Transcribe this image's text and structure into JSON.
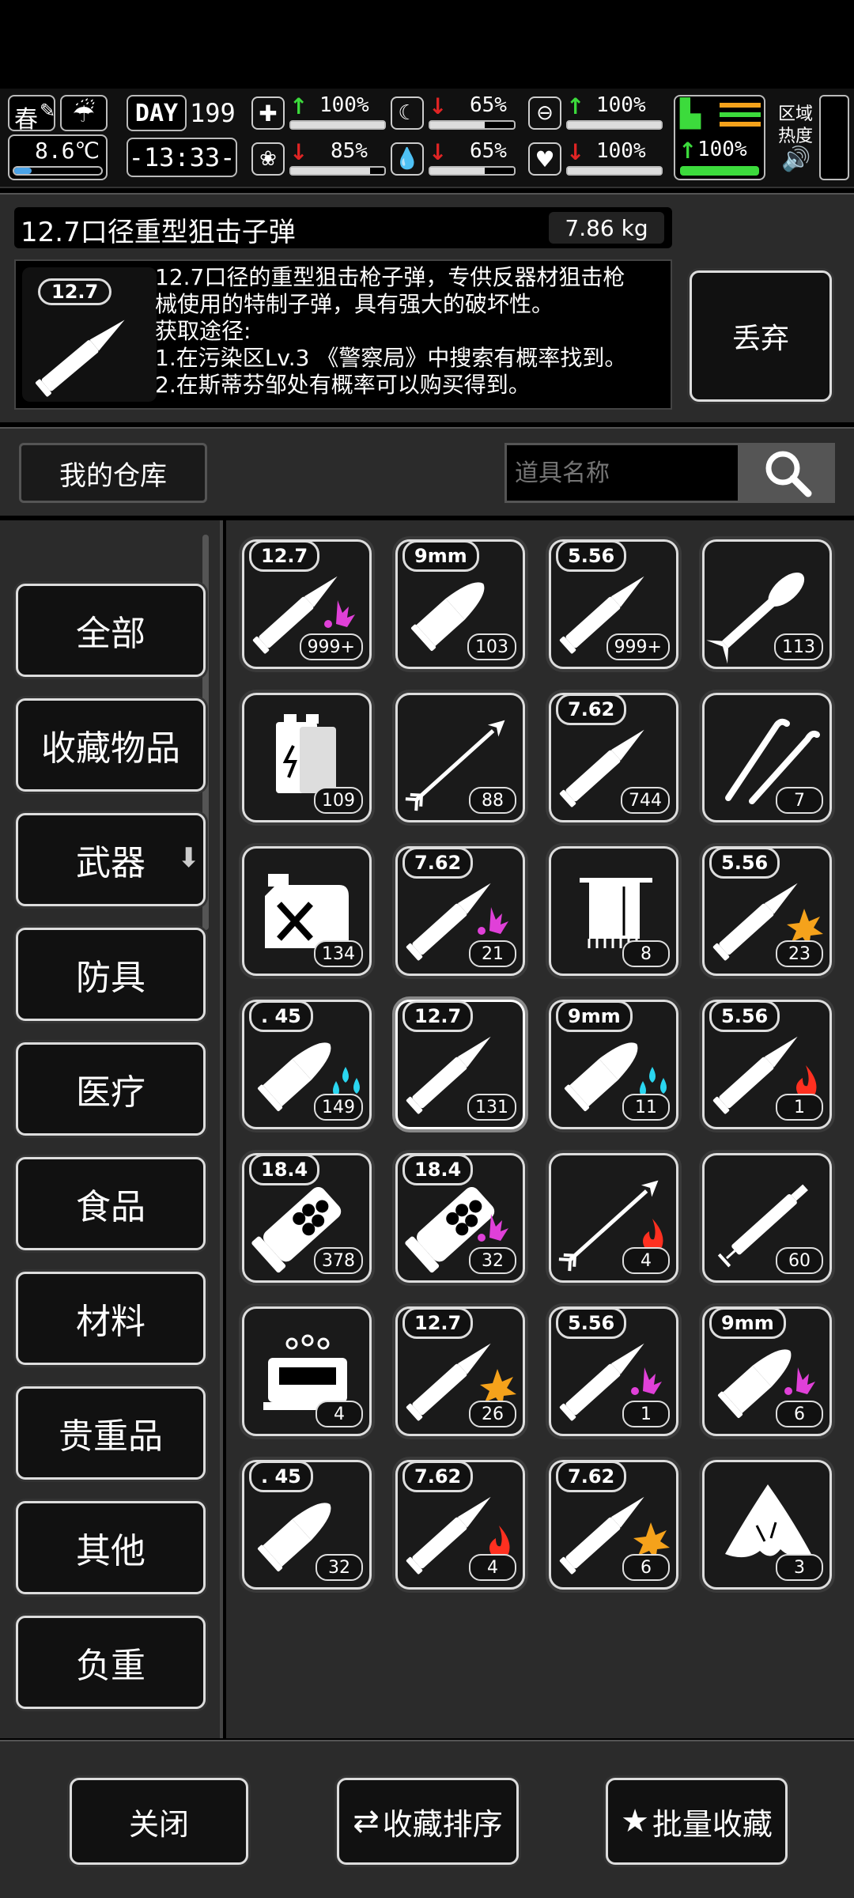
{
  "hud": {
    "season": "春",
    "day_label": "DAY",
    "day_number": "199",
    "temperature": "8.6℃",
    "time": "-13:33-",
    "region_heat_label_1": "区域",
    "region_heat_label_2": "热度",
    "stats": [
      {
        "name": "health",
        "dir": "up",
        "value": "100%",
        "fill": 100
      },
      {
        "name": "hunger",
        "dir": "down",
        "value": "65%",
        "fill": 65
      },
      {
        "name": "stamina",
        "dir": "up",
        "value": "100%",
        "fill": 100
      },
      {
        "name": "sanity",
        "dir": "down",
        "value": "85%",
        "fill": 85
      },
      {
        "name": "thirst",
        "dir": "down",
        "value": "65%",
        "fill": 65
      },
      {
        "name": "mood",
        "dir": "down",
        "value": "100%",
        "fill": 100
      },
      {
        "name": "speed",
        "dir": "up",
        "value": "100%",
        "fill": 100
      }
    ]
  },
  "detail": {
    "name": "12.7口径重型狙击子弹",
    "weight": "7.86 kg",
    "caliber_badge": "12.7",
    "desc_lines": [
      "12.7口径的重型狙击枪子弹，专供反器材狙击枪",
      "械使用的特制子弹，具有强大的破坏性。",
      "获取途径:",
      "1.在污染区Lv.3 《警察局》中搜索有概率找到。",
      "2.在斯蒂芬邹处有概率可以购买得到。"
    ],
    "discard_label": "丢弃"
  },
  "warehouse": {
    "title": "我的仓库",
    "search_placeholder": "道具名称"
  },
  "categories": [
    "全部",
    "收藏物品",
    "武器",
    "防具",
    "医疗",
    "食品",
    "材料",
    "贵重品",
    "其他",
    "负重"
  ],
  "items": [
    {
      "cal": "12.7",
      "count": "999+",
      "icon": "bullet",
      "mark": "magenta"
    },
    {
      "cal": "9mm",
      "count": "103",
      "icon": "pistol-round",
      "mark": ""
    },
    {
      "cal": "5.56",
      "count": "999+",
      "icon": "bullet",
      "mark": ""
    },
    {
      "cal": "",
      "count": "113",
      "icon": "rocket",
      "mark": ""
    },
    {
      "cal": "",
      "count": "109",
      "icon": "battery",
      "mark": ""
    },
    {
      "cal": "",
      "count": "88",
      "icon": "arrow",
      "mark": ""
    },
    {
      "cal": "7.62",
      "count": "744",
      "icon": "bullet",
      "mark": ""
    },
    {
      "cal": "",
      "count": "7",
      "icon": "lockpick",
      "mark": ""
    },
    {
      "cal": "",
      "count": "134",
      "icon": "fuel-can",
      "mark": ""
    },
    {
      "cal": "7.62",
      "count": "21",
      "icon": "bullet",
      "mark": "magenta"
    },
    {
      "cal": "",
      "count": "8",
      "icon": "towel",
      "mark": ""
    },
    {
      "cal": "5.56",
      "count": "23",
      "icon": "bullet",
      "mark": "orange"
    },
    {
      "cal": ". 45",
      "count": "149",
      "icon": "pistol-round",
      "mark": "cyan"
    },
    {
      "cal": "12.7",
      "count": "131",
      "icon": "bullet",
      "mark": "",
      "selected": true
    },
    {
      "cal": "9mm",
      "count": "11",
      "icon": "pistol-round",
      "mark": "cyan"
    },
    {
      "cal": "5.56",
      "count": "1",
      "icon": "bullet",
      "mark": "red"
    },
    {
      "cal": "18.4",
      "count": "378",
      "icon": "shell",
      "mark": ""
    },
    {
      "cal": "18.4",
      "count": "32",
      "icon": "shell",
      "mark": "magenta"
    },
    {
      "cal": "",
      "count": "4",
      "icon": "arrow",
      "mark": "red"
    },
    {
      "cal": "",
      "count": "60",
      "icon": "syringe",
      "mark": ""
    },
    {
      "cal": "",
      "count": "4",
      "icon": "machine",
      "mark": ""
    },
    {
      "cal": "12.7",
      "count": "26",
      "icon": "bullet",
      "mark": "orange"
    },
    {
      "cal": "5.56",
      "count": "1",
      "icon": "bullet",
      "mark": "magenta"
    },
    {
      "cal": "9mm",
      "count": "6",
      "icon": "pistol-round",
      "mark": "magenta"
    },
    {
      "cal": ". 45",
      "count": "32",
      "icon": "pistol-round",
      "mark": ""
    },
    {
      "cal": "7.62",
      "count": "4",
      "icon": "bullet",
      "mark": "red"
    },
    {
      "cal": "7.62",
      "count": "6",
      "icon": "bullet",
      "mark": "orange"
    },
    {
      "cal": "",
      "count": "3",
      "icon": "cloth",
      "mark": ""
    }
  ],
  "bottom": {
    "close": "关闭",
    "sort": "收藏排序",
    "batch": "批量收藏"
  },
  "colors": {
    "magenta": "#e040d8",
    "orange": "#f5a21b",
    "cyan": "#2ad6f0",
    "red": "#ff3020",
    "green": "#3cdb3c"
  }
}
